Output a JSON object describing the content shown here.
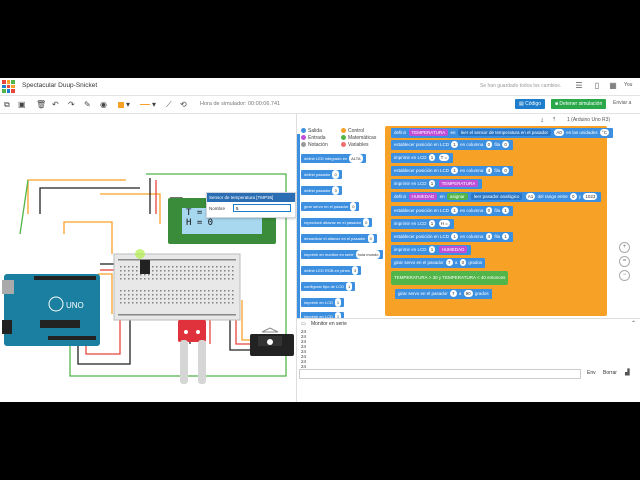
{
  "app": {
    "project_title": "Spectacular Duup-Snicket",
    "save_status": "Se han guardado todos los cambios.",
    "user_label": "You"
  },
  "toolbar": {
    "sim_time": "Hora de simulador: 00:00:06.741",
    "code_label": "Código",
    "stop_sim_label": "Detener simulación",
    "send_label": "Enviar a"
  },
  "component_panel": {
    "title": "Sensor de temperatura [TMP36]",
    "name_label": "Nombre",
    "name_value": "5"
  },
  "lcd": {
    "line1": "T = 24",
    "line2": "H = 0"
  },
  "code_header": {
    "device": "1 (Arduino Uno R3)"
  },
  "categories": [
    {
      "label": "Salida",
      "color": "#3d8fe0"
    },
    {
      "label": "Control",
      "color": "#f7a226"
    },
    {
      "label": "Entrada",
      "color": "#c04fd8"
    },
    {
      "label": "Matemáticas",
      "color": "#52b54a"
    },
    {
      "label": "Notación",
      "color": "#999999"
    },
    {
      "label": "Variables",
      "color": "#f26d6d"
    }
  ],
  "palette": [
    {
      "text": "definir LED integrado en",
      "value": "ALTA"
    },
    {
      "text": "definir pasador",
      "value": "0"
    },
    {
      "text": "definir pasador",
      "value": "3"
    },
    {
      "text": "girar servo en el pasador",
      "value": "0"
    },
    {
      "text": "reproducir altavoz en el pasador",
      "value": "0"
    },
    {
      "text": "desactivar el altavoz en el pasador",
      "value": "0"
    },
    {
      "text": "imprimir en monitor en serie",
      "value": "hola mundo"
    },
    {
      "text": "definir LED RGB en pines",
      "value": "3"
    },
    {
      "text": "configurar tipo de LCD",
      "value": "1"
    },
    {
      "text": "imprimir en LCD",
      "value": "1"
    },
    {
      "text": "imprimir en LCD",
      "value": "1"
    }
  ],
  "script_blocks": [
    {
      "kind": "blue",
      "pre": "definir",
      "var": "TEMPERATURA",
      "mid": "en",
      "rest": "leer el sensor de temperatura en el pasador",
      "v1": "A0",
      "post": "en las unidades",
      "v2": "°C"
    },
    {
      "kind": "blue",
      "text": "establecer posición en LCD",
      "v1": "1",
      "mid": "en columna",
      "v2": "0",
      "post": "fila",
      "v3": "0"
    },
    {
      "kind": "blue",
      "text": "imprimir en LCD",
      "v1": "1",
      "v2": "T = "
    },
    {
      "kind": "blue",
      "text": "establecer posición en LCD",
      "v1": "1",
      "mid": "en columna",
      "v2": "4",
      "post": "fila",
      "v3": "0"
    },
    {
      "kind": "blue",
      "text": "imprimir en LCD",
      "v1": "1",
      "var": "TEMPERATURA"
    },
    {
      "kind": "blue",
      "pre": "definir",
      "var": "HUMEDAD",
      "mid": "en",
      "rest": "asignar",
      "b": "leer pasador analógico",
      "v1": "A1",
      "post": "del rango entre",
      "v2": "0",
      "post2": "y",
      "v3": "1023"
    },
    {
      "kind": "blue",
      "text": "establecer posición en LCD",
      "v1": "1",
      "mid": "en columna",
      "v2": "0",
      "post": "fila",
      "v3": "1"
    },
    {
      "kind": "blue",
      "text": "imprimir en LCD",
      "v1": "1",
      "v2": "H = "
    },
    {
      "kind": "blue",
      "text": "establecer posición en LCD",
      "v1": "1",
      "mid": "en columna",
      "v2": "4",
      "post": "fila",
      "v3": "1"
    },
    {
      "kind": "blue",
      "text": "imprimir en LCD",
      "v1": "1",
      "var": "HUMEDAD"
    },
    {
      "kind": "blue",
      "text": "girar servo en el pasador",
      "v1": "7",
      "post": "a",
      "v2": "0",
      "post2": "grados"
    },
    {
      "kind": "green",
      "var1": "TEMPERATURA",
      "op1": ">",
      "v1": "30",
      "mid": "y",
      "var2": "TEMPERATURA",
      "op2": "<",
      "v2": "40",
      "post": "entonces"
    },
    {
      "kind": "blue",
      "text": "girar servo en el pasador",
      "v1": "7",
      "post": "a",
      "v2": "90",
      "post2": "grados"
    }
  ],
  "serial": {
    "title": "Monitor en serie",
    "lines": [
      "24",
      "24",
      "24",
      "24",
      "24",
      "24",
      "24",
      "24"
    ],
    "send": "Env",
    "clear": "Borrar"
  }
}
